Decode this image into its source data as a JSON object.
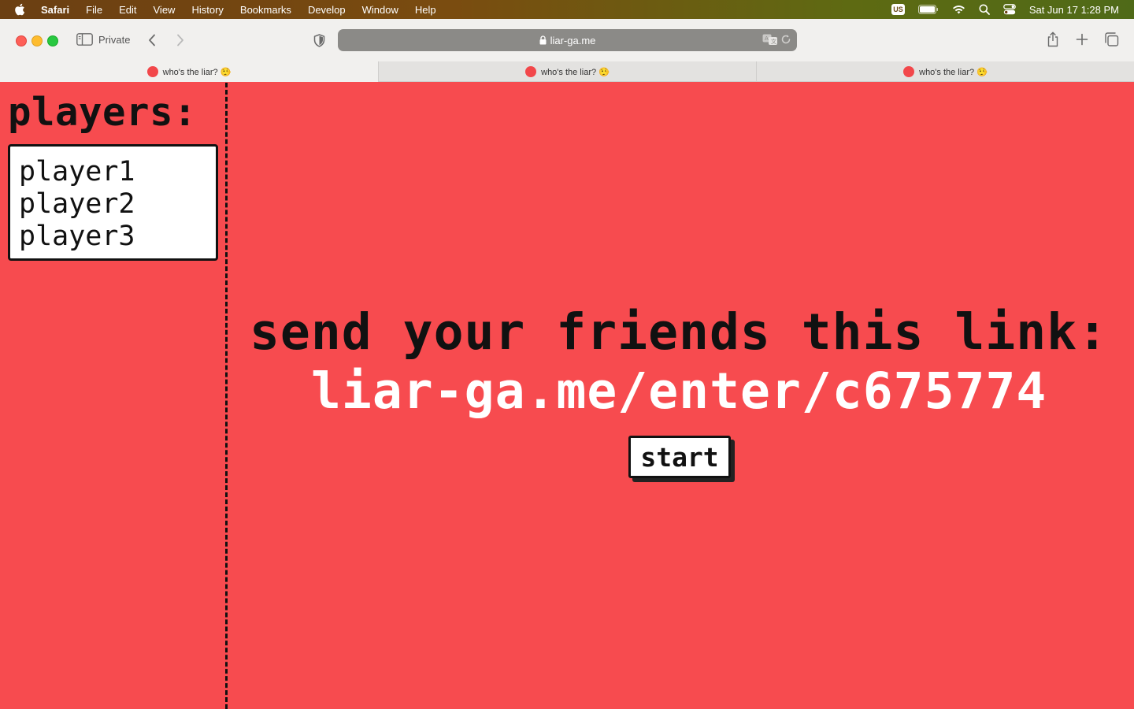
{
  "menubar": {
    "app": "Safari",
    "items": [
      "File",
      "Edit",
      "View",
      "History",
      "Bookmarks",
      "Develop",
      "Window",
      "Help"
    ],
    "input_source": "US",
    "clock": "Sat Jun 17  1:28 PM"
  },
  "toolbar": {
    "private_label": "Private",
    "address": "liar-ga.me"
  },
  "tabs": [
    {
      "title": "who's the liar? 🤥"
    },
    {
      "title": "who's the liar? 🤥"
    },
    {
      "title": "who's the liar? 🤥"
    }
  ],
  "page": {
    "players_title": "players:",
    "players": [
      "player1",
      "player2",
      "player3"
    ],
    "share_title": "send your friends this link:",
    "share_link": "liar-ga.me/enter/c675774",
    "start_label": "start"
  },
  "colors": {
    "background": "#f74b4f",
    "link_text": "#ffffff",
    "favicon": "#f2474a"
  }
}
